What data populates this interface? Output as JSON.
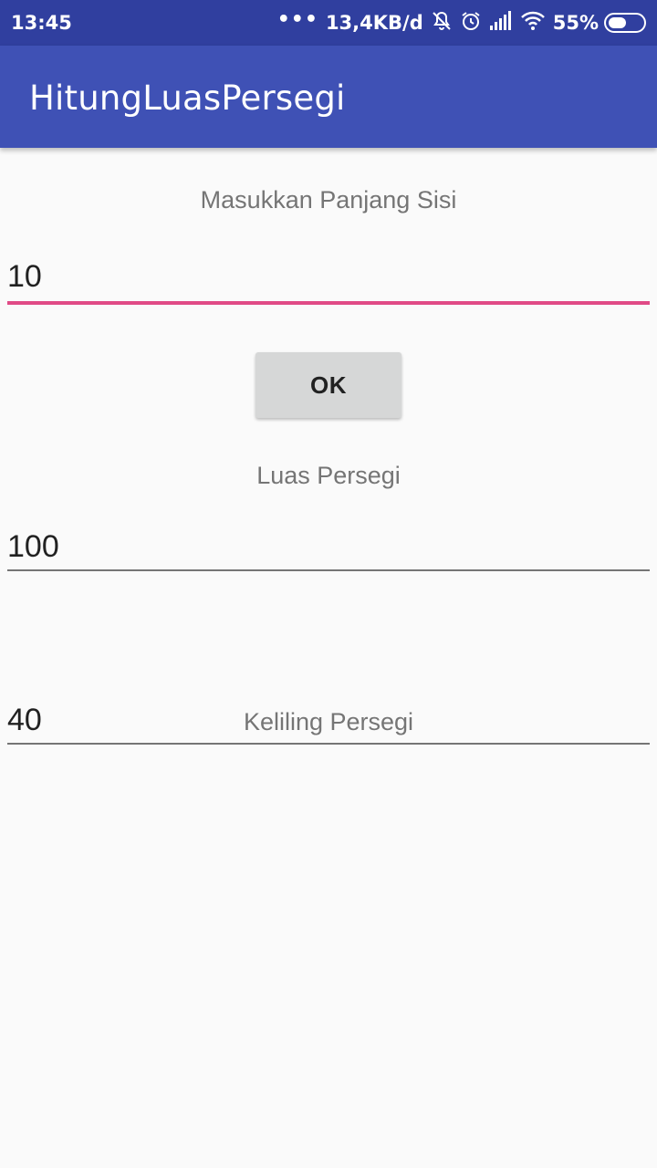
{
  "status_bar": {
    "time": "13:45",
    "dots": "•••",
    "net_speed": "13,4KB/d",
    "battery_percent": "55%",
    "battery_level": 0.55,
    "icons": [
      "notifications-off-icon",
      "alarm-icon",
      "signal-icon",
      "wifi-icon",
      "battery-icon"
    ]
  },
  "app_bar": {
    "title": "HitungLuasPersegi",
    "color": "#3f51b5"
  },
  "form": {
    "input_label": "Masukkan Panjang Sisi",
    "input_value": "10",
    "ok_label": "OK",
    "luas_label": "Luas Persegi",
    "luas_value": "100",
    "keliling_label": "Keliling Persegi",
    "keliling_value": "40"
  },
  "colors": {
    "accent": "#e04a86",
    "status_bar": "#303f9f"
  }
}
